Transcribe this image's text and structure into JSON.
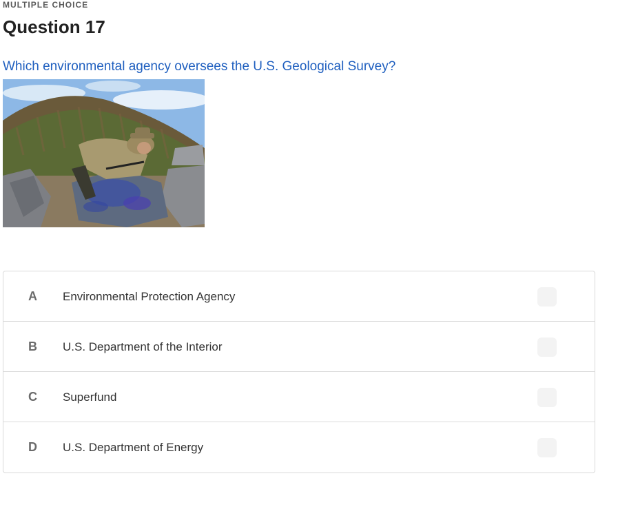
{
  "question": {
    "type_label": "MULTIPLE CHOICE",
    "title": "Question 17",
    "text": "Which environmental agency oversees the U.S. Geological Survey?",
    "image_alt": "Geologist in a hat examining a large rock with a magnifying tool in front of a hill"
  },
  "options": [
    {
      "letter": "A",
      "label": "Environmental Protection Agency"
    },
    {
      "letter": "B",
      "label": "U.S. Department of the Interior"
    },
    {
      "letter": "C",
      "label": "Superfund"
    },
    {
      "letter": "D",
      "label": "U.S. Department of Energy"
    }
  ],
  "colors": {
    "question_text": "#1f5fbf",
    "title": "#222222",
    "border": "#d9d9d9",
    "checkbox_bg": "#f3f3f3"
  }
}
